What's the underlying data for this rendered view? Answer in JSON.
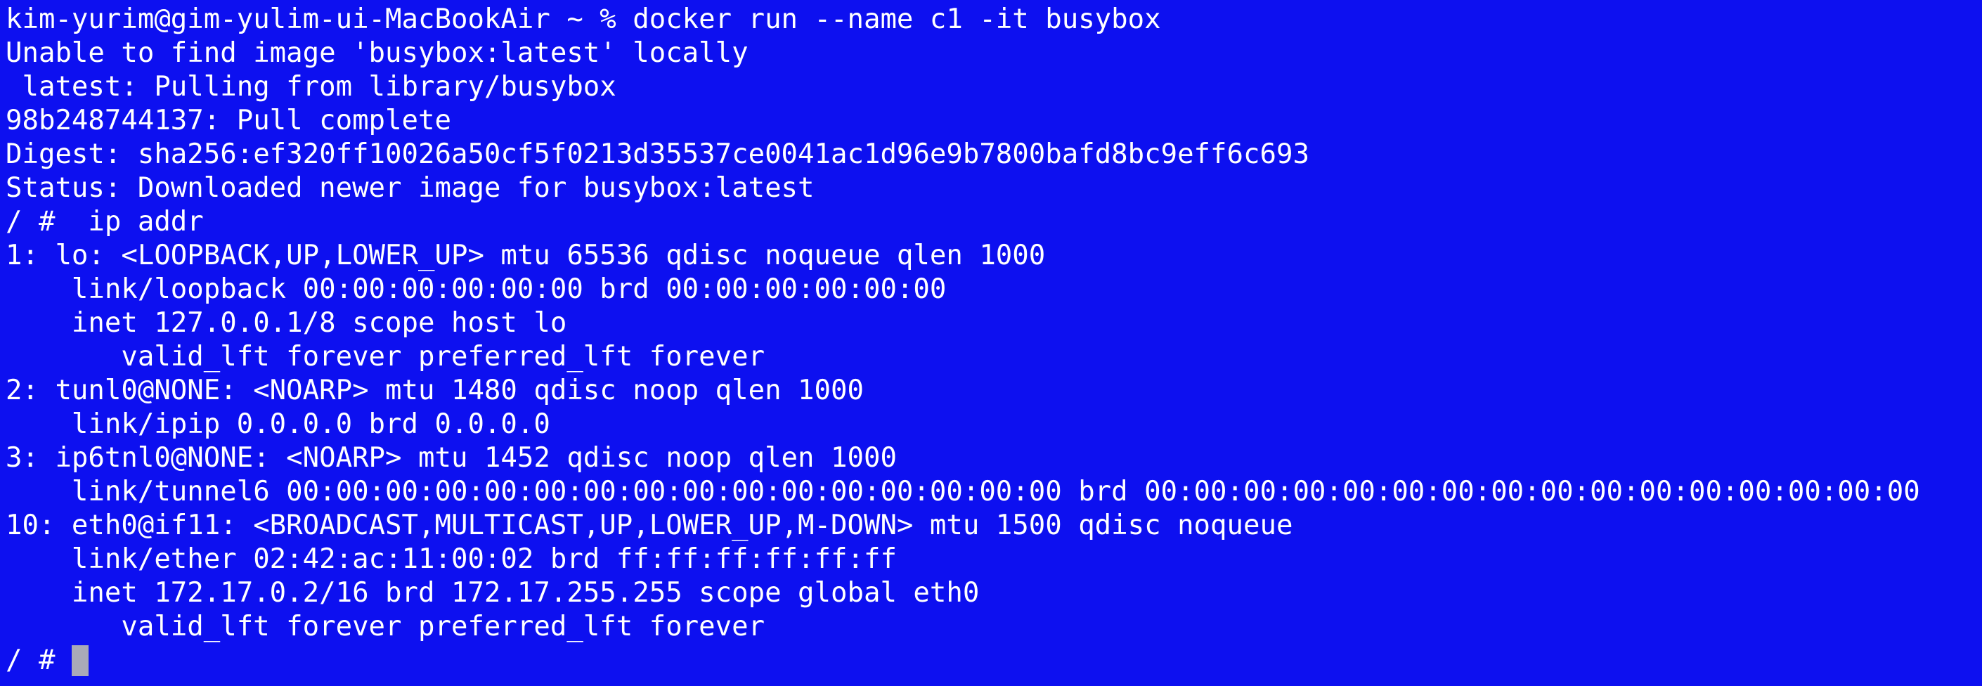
{
  "terminal": {
    "lines": [
      "kim-yurim@gim-yulim-ui-MacBookAir ~ % docker run --name c1 -it busybox",
      "Unable to find image 'busybox:latest' locally",
      " latest: Pulling from library/busybox",
      "98b248744137: Pull complete",
      "Digest: sha256:ef320ff10026a50cf5f0213d35537ce0041ac1d96e9b7800bafd8bc9eff6c693",
      "Status: Downloaded newer image for busybox:latest",
      "/ #  ip addr",
      "1: lo: <LOOPBACK,UP,LOWER_UP> mtu 65536 qdisc noqueue qlen 1000",
      "    link/loopback 00:00:00:00:00:00 brd 00:00:00:00:00:00",
      "    inet 127.0.0.1/8 scope host lo",
      "       valid_lft forever preferred_lft forever",
      "2: tunl0@NONE: <NOARP> mtu 1480 qdisc noop qlen 1000",
      "    link/ipip 0.0.0.0 brd 0.0.0.0",
      "3: ip6tnl0@NONE: <NOARP> mtu 1452 qdisc noop qlen 1000",
      "    link/tunnel6 00:00:00:00:00:00:00:00:00:00:00:00:00:00:00:00 brd 00:00:00:00:00:00:00:00:00:00:00:00:00:00:00:00",
      "10: eth0@if11: <BROADCAST,MULTICAST,UP,LOWER_UP,M-DOWN> mtu 1500 qdisc noqueue",
      "    link/ether 02:42:ac:11:00:02 brd ff:ff:ff:ff:ff:ff",
      "    inet 172.17.0.2/16 brd 172.17.255.255 scope global eth0",
      "       valid_lft forever preferred_lft forever"
    ],
    "prompt": "/ # "
  }
}
